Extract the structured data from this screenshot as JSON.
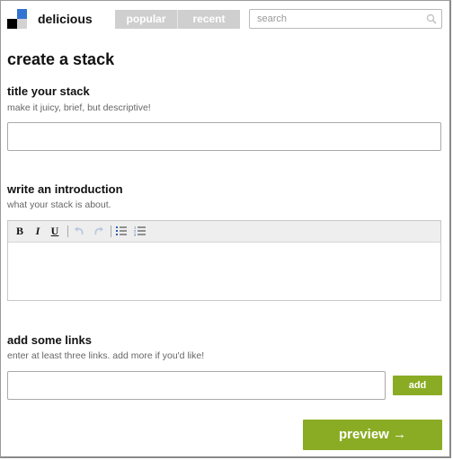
{
  "header": {
    "brand": "delicious",
    "tabs": [
      {
        "label": "popular"
      },
      {
        "label": "recent"
      }
    ],
    "search": {
      "placeholder": "search",
      "value": ""
    }
  },
  "page_title": "create a stack",
  "title_section": {
    "label": "title your stack",
    "hint": "make it juicy, brief, but descriptive!",
    "value": ""
  },
  "intro_section": {
    "label": "write an introduction",
    "hint": "what your stack is about.",
    "toolbar": {
      "bold": "B",
      "italic": "I",
      "underline": "U",
      "icons": [
        "undo-icon",
        "redo-icon",
        "bulleted-list-icon",
        "numbered-list-icon"
      ]
    },
    "value": ""
  },
  "links_section": {
    "label": "add some links",
    "hint": "enter at least three links. add more if you'd like!",
    "value": "",
    "add_label": "add"
  },
  "preview_label": "preview →",
  "colors": {
    "logo_blue": "#3274d1",
    "logo_black": "#000000",
    "logo_gray": "#d3d2d2",
    "accent_green": "#8aac24",
    "tab_gray": "#cfcfcf"
  }
}
